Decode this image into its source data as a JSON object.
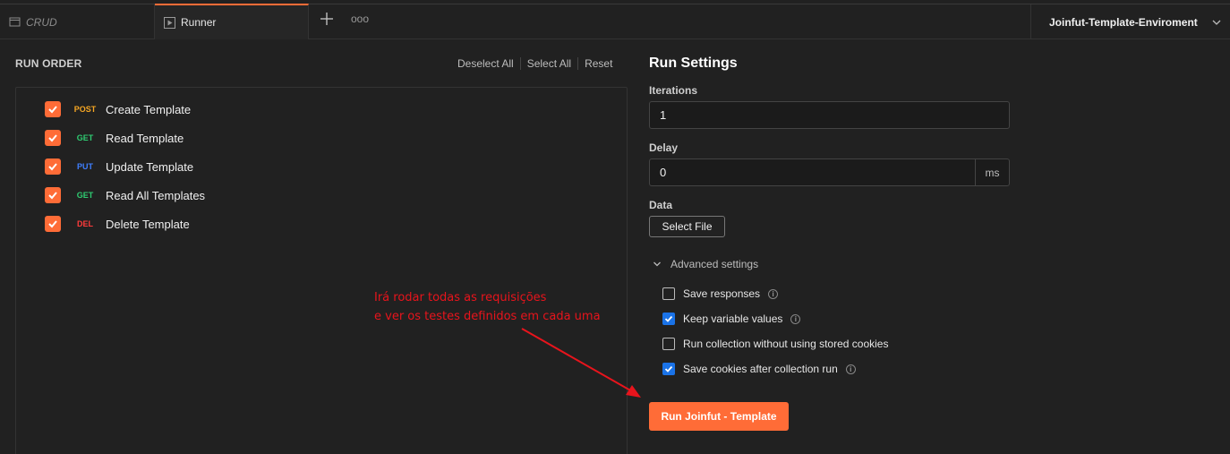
{
  "tabs": {
    "crud_label": "CRUD",
    "runner_label": "Runner",
    "more_label": "ooo"
  },
  "environment": {
    "selected": "Joinfut-Template-Enviroment"
  },
  "run_order": {
    "title": "RUN ORDER",
    "deselect_all": "Deselect All",
    "select_all": "Select All",
    "reset": "Reset",
    "requests": [
      {
        "method": "POST",
        "method_color": "#f5a623",
        "name": "Create Template",
        "checked": true
      },
      {
        "method": "GET",
        "method_color": "#2ecc71",
        "name": "Read Template",
        "checked": true
      },
      {
        "method": "PUT",
        "method_color": "#3f7fff",
        "name": "Update Template",
        "checked": true
      },
      {
        "method": "GET",
        "method_color": "#2ecc71",
        "name": "Read All Templates",
        "checked": true
      },
      {
        "method": "DEL",
        "method_color": "#ff3b3b",
        "name": "Delete Template",
        "checked": true
      }
    ]
  },
  "run_settings": {
    "title": "Run Settings",
    "iterations_label": "Iterations",
    "iterations_value": "1",
    "delay_label": "Delay",
    "delay_value": "0",
    "delay_unit": "ms",
    "data_label": "Data",
    "select_file_label": "Select File",
    "advanced_label": "Advanced settings",
    "options": [
      {
        "label": "Save responses",
        "checked": false,
        "info": true
      },
      {
        "label": "Keep variable values",
        "checked": true,
        "info": true
      },
      {
        "label": "Run collection without using stored cookies",
        "checked": false,
        "info": false
      },
      {
        "label": "Save cookies after collection run",
        "checked": true,
        "info": true
      }
    ],
    "run_button_label": "Run Joinfut - Template"
  },
  "annotation": {
    "line1": "Irá rodar todas as requisições",
    "line2": "e ver os testes definidos em cada uma"
  },
  "colors": {
    "accent": "#ff6c37",
    "checkbox_blue": "#1a73e8",
    "annotation_red": "#e8141c"
  }
}
